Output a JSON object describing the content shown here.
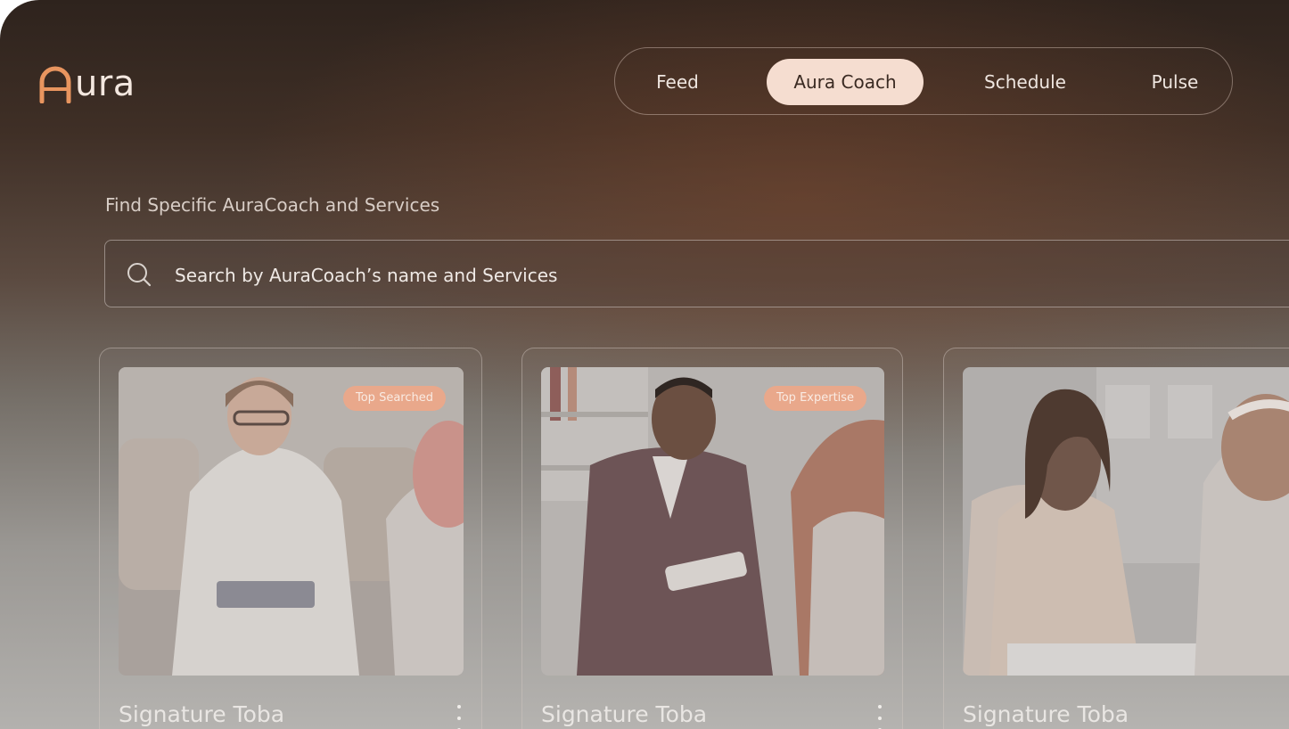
{
  "brand": {
    "name": "ura",
    "accent_color": "#e8955f",
    "logo_icon": "aura-arch-logo-icon"
  },
  "nav": {
    "items": [
      {
        "label": "Feed",
        "active": false
      },
      {
        "label": "Aura Coach",
        "active": true
      },
      {
        "label": "Schedule",
        "active": false
      },
      {
        "label": "Pulse",
        "active": false
      }
    ]
  },
  "search_section": {
    "label": "Find Specific AuraCoach and Services",
    "placeholder": "Search by AuraCoach’s name and Services",
    "icon": "search-icon"
  },
  "coaches": [
    {
      "name": "Signature Toba",
      "badge": "Top Searched",
      "menu_icon": "kebab-icon"
    },
    {
      "name": "Signature Toba",
      "badge": "Top Expertise",
      "menu_icon": "kebab-icon"
    },
    {
      "name": "Signature Toba",
      "badge": "",
      "menu_icon": "kebab-icon"
    }
  ],
  "colors": {
    "active_tab_bg": "#f5ddd0",
    "badge_bg": "#e9a88b"
  }
}
